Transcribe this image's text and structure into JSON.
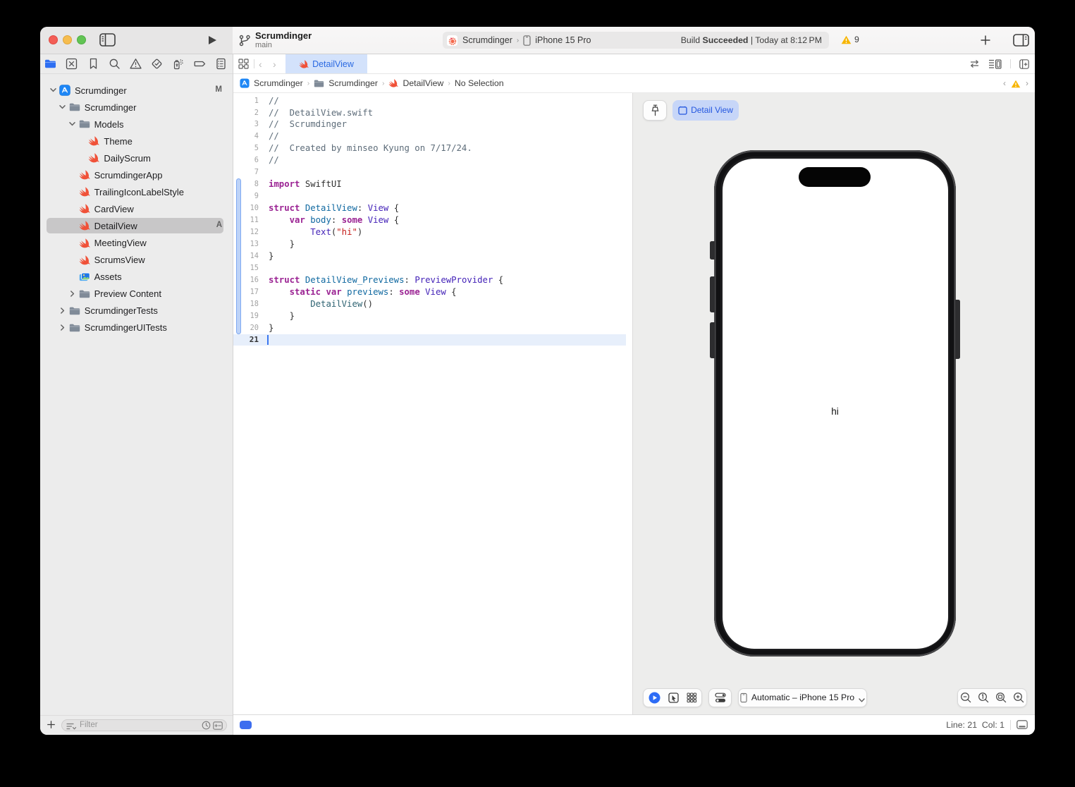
{
  "window": {
    "title": "Scrumdinger",
    "subtitle": "main"
  },
  "toolbar": {
    "scheme_app": "Scrumdinger",
    "scheme_chevron": "›",
    "scheme_device": "iPhone 15 Pro",
    "build_status": "Build Succeeded | Today at 8:12 PM",
    "build_prefix": "Build ",
    "build_bold": "Succeeded",
    "build_suffix": " | Today at 8:12 PM",
    "warning_count": "9"
  },
  "tabbar": {
    "active_tab": "DetailView",
    "back_chevron": "‹",
    "forward_chevron": "›"
  },
  "breadcrumb": {
    "items": [
      {
        "icon": "app",
        "label": "Scrumdinger"
      },
      {
        "icon": "folder",
        "label": "Scrumdinger"
      },
      {
        "icon": "swift",
        "label": "DetailView"
      },
      {
        "icon": "none",
        "label": "No Selection"
      }
    ],
    "chevron": "›",
    "back": "‹",
    "forward": "›"
  },
  "sidebar": {
    "items": [
      {
        "level": 0,
        "chevron": "down",
        "icon": "app",
        "label": "Scrumdinger",
        "badge": "M"
      },
      {
        "level": 1,
        "chevron": "down",
        "icon": "folder",
        "label": "Scrumdinger"
      },
      {
        "level": 2,
        "chevron": "down",
        "icon": "folder",
        "label": "Models"
      },
      {
        "level": 3,
        "chevron": "none",
        "icon": "swift",
        "label": "Theme"
      },
      {
        "level": 3,
        "chevron": "none",
        "icon": "swift",
        "label": "DailyScrum"
      },
      {
        "level": 2,
        "chevron": "none",
        "icon": "swift",
        "label": "ScrumdingerApp"
      },
      {
        "level": 2,
        "chevron": "none",
        "icon": "swift",
        "label": "TrailingIconLabelStyle"
      },
      {
        "level": 2,
        "chevron": "none",
        "icon": "swift",
        "label": "CardView"
      },
      {
        "level": 2,
        "chevron": "none",
        "icon": "swift",
        "label": "DetailView",
        "badge": "A",
        "selected": true
      },
      {
        "level": 2,
        "chevron": "none",
        "icon": "swift",
        "label": "MeetingView"
      },
      {
        "level": 2,
        "chevron": "none",
        "icon": "swift",
        "label": "ScrumsView"
      },
      {
        "level": 2,
        "chevron": "none",
        "icon": "assets",
        "label": "Assets"
      },
      {
        "level": 2,
        "chevron": "right",
        "icon": "folder",
        "label": "Preview Content"
      },
      {
        "level": 1,
        "chevron": "right",
        "icon": "folder",
        "label": "ScrumdingerTests"
      },
      {
        "level": 1,
        "chevron": "right",
        "icon": "folder",
        "label": "ScrumdingerUITests"
      }
    ],
    "filter_placeholder": "Filter"
  },
  "editor": {
    "lines": [
      {
        "n": "1",
        "tokens": [
          [
            "c",
            "//"
          ]
        ]
      },
      {
        "n": "2",
        "tokens": [
          [
            "c",
            "//  DetailView.swift"
          ]
        ]
      },
      {
        "n": "3",
        "tokens": [
          [
            "c",
            "//  Scrumdinger"
          ]
        ]
      },
      {
        "n": "4",
        "tokens": [
          [
            "c",
            "//"
          ]
        ]
      },
      {
        "n": "5",
        "tokens": [
          [
            "c",
            "//  Created by minseo Kyung on 7/17/24."
          ]
        ]
      },
      {
        "n": "6",
        "tokens": [
          [
            "c",
            "//"
          ]
        ]
      },
      {
        "n": "7",
        "tokens": []
      },
      {
        "n": "8",
        "tokens": [
          [
            "k",
            "import"
          ],
          [
            "p",
            " SwiftUI"
          ]
        ]
      },
      {
        "n": "9",
        "tokens": []
      },
      {
        "n": "10",
        "tokens": [
          [
            "k",
            "struct"
          ],
          [
            "p",
            " "
          ],
          [
            "d",
            "DetailView"
          ],
          [
            "p",
            ": "
          ],
          [
            "t",
            "View"
          ],
          [
            "p",
            " {"
          ]
        ]
      },
      {
        "n": "11",
        "tokens": [
          [
            "p",
            "    "
          ],
          [
            "k",
            "var"
          ],
          [
            "p",
            " "
          ],
          [
            "d",
            "body"
          ],
          [
            "p",
            ": "
          ],
          [
            "k",
            "some"
          ],
          [
            "p",
            " "
          ],
          [
            "t",
            "View"
          ],
          [
            "p",
            " {"
          ]
        ]
      },
      {
        "n": "12",
        "tokens": [
          [
            "p",
            "        "
          ],
          [
            "t",
            "Text"
          ],
          [
            "p",
            "("
          ],
          [
            "s",
            "\"hi\""
          ],
          [
            "p",
            ")"
          ]
        ]
      },
      {
        "n": "13",
        "tokens": [
          [
            "p",
            "    }"
          ]
        ]
      },
      {
        "n": "14",
        "tokens": [
          [
            "p",
            "}"
          ]
        ]
      },
      {
        "n": "15",
        "tokens": []
      },
      {
        "n": "16",
        "tokens": [
          [
            "k",
            "struct"
          ],
          [
            "p",
            " "
          ],
          [
            "d",
            "DetailView_Previews"
          ],
          [
            "p",
            ": "
          ],
          [
            "t",
            "PreviewProvider"
          ],
          [
            "p",
            " {"
          ]
        ]
      },
      {
        "n": "17",
        "tokens": [
          [
            "p",
            "    "
          ],
          [
            "k",
            "static"
          ],
          [
            "p",
            " "
          ],
          [
            "k",
            "var"
          ],
          [
            "p",
            " "
          ],
          [
            "d",
            "previews"
          ],
          [
            "p",
            ": "
          ],
          [
            "k",
            "some"
          ],
          [
            "p",
            " "
          ],
          [
            "t",
            "View"
          ],
          [
            "p",
            " {"
          ]
        ]
      },
      {
        "n": "18",
        "tokens": [
          [
            "p",
            "        "
          ],
          [
            "pc",
            "DetailView"
          ],
          [
            "p",
            "()"
          ]
        ]
      },
      {
        "n": "19",
        "tokens": [
          [
            "p",
            "    }"
          ]
        ]
      },
      {
        "n": "20",
        "tokens": [
          [
            "p",
            "}"
          ]
        ]
      },
      {
        "n": "21",
        "tokens": [],
        "current": true
      }
    ],
    "change_bar": {
      "from_line": 8,
      "to_line": 20
    },
    "status": "Line: 21  Col: 1"
  },
  "canvas": {
    "preview_pin_tab": "Detail View",
    "device_screen_text": "hi",
    "device_picker": "Automatic – iPhone 15 Pro"
  },
  "colors": {
    "accent_blue": "#2b6ae2",
    "tab_blue_bg": "#d3e2fb",
    "selection_gray": "#c8c7c8",
    "swift_orange": "#f05138",
    "warning_yellow": "#f7b500",
    "keyword": "#9b2393",
    "comment": "#5d6c79",
    "declaration": "#0f68a0",
    "type_name": "#4423b8",
    "string_red": "#c41a16",
    "project_class": "#2e6372"
  }
}
